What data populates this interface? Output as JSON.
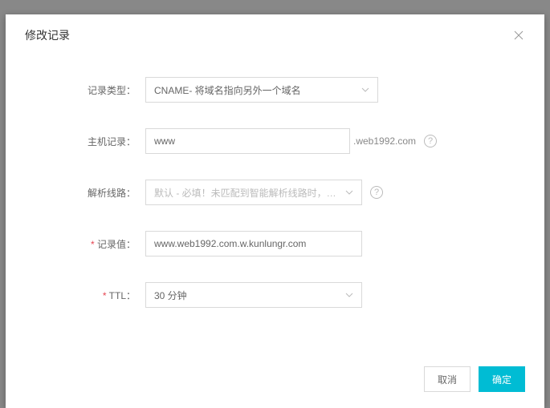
{
  "modal": {
    "title": "修改记录"
  },
  "form": {
    "record_type": {
      "label": "记录类型：",
      "value": "CNAME- 将域名指向另外一个域名"
    },
    "host_record": {
      "label": "主机记录：",
      "value": "www",
      "suffix": ".web1992.com"
    },
    "resolution_line": {
      "label": "解析线路：",
      "placeholder": "默认 - 必填！未匹配到智能解析线路时，返回【默认】线路..."
    },
    "record_value": {
      "label": "记录值：",
      "value": "www.web1992.com.w.kunlungr.com"
    },
    "ttl": {
      "label": "TTL：",
      "value": "30 分钟"
    }
  },
  "footer": {
    "cancel": "取消",
    "confirm": "确定"
  },
  "help": "?"
}
